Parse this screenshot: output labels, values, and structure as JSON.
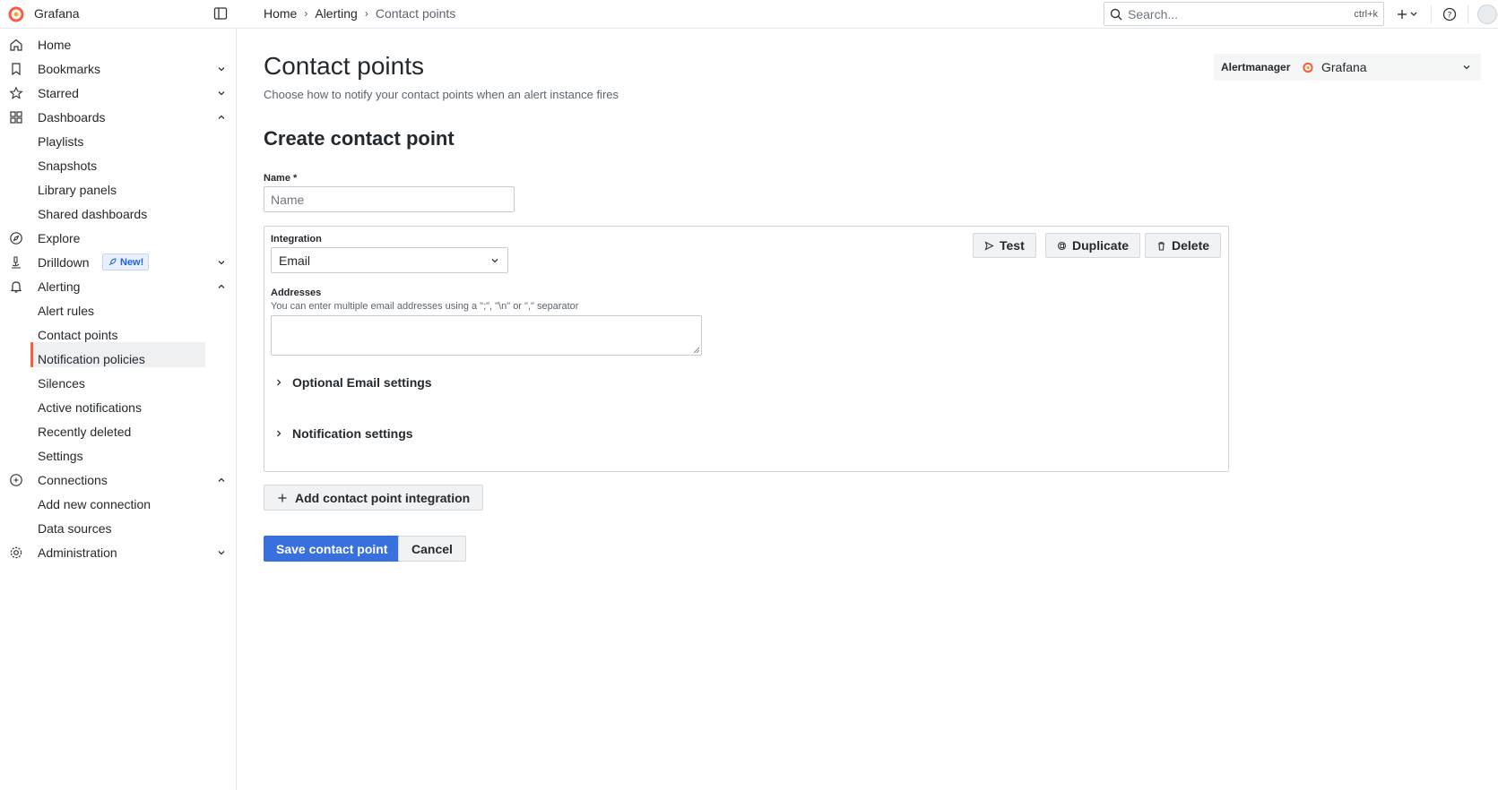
{
  "app": {
    "name": "Grafana",
    "logo_color": "#f55f3e"
  },
  "breadcrumbs": [
    "Home",
    "Alerting",
    "Contact points"
  ],
  "search": {
    "placeholder": "Search...",
    "shortcut": "ctrl+k"
  },
  "sidebar": {
    "items": [
      {
        "label": "Home",
        "icon": "home-icon"
      },
      {
        "label": "Bookmarks",
        "icon": "bookmark-icon",
        "expand": "down"
      },
      {
        "label": "Starred",
        "icon": "star-icon",
        "expand": "down"
      },
      {
        "label": "Dashboards",
        "icon": "apps-icon",
        "expand": "up"
      },
      {
        "label": "Playlists",
        "child": true
      },
      {
        "label": "Snapshots",
        "child": true
      },
      {
        "label": "Library panels",
        "child": true
      },
      {
        "label": "Shared dashboards",
        "child": true
      },
      {
        "label": "Explore",
        "icon": "compass-icon"
      },
      {
        "label": "Drilldown",
        "icon": "microscope-icon",
        "expand": "down",
        "badge": "New!"
      },
      {
        "label": "Alerting",
        "icon": "bell-icon",
        "expand": "up"
      },
      {
        "label": "Alert rules",
        "child": true
      },
      {
        "label": "Contact points",
        "child": true,
        "active": true
      },
      {
        "label": "Notification policies",
        "child": true
      },
      {
        "label": "Silences",
        "child": true
      },
      {
        "label": "Active notifications",
        "child": true
      },
      {
        "label": "Recently deleted",
        "child": true
      },
      {
        "label": "Settings",
        "child": true
      },
      {
        "label": "Connections",
        "icon": "link-icon",
        "expand": "up"
      },
      {
        "label": "Add new connection",
        "child": true
      },
      {
        "label": "Data sources",
        "child": true
      },
      {
        "label": "Administration",
        "icon": "cog-icon",
        "expand": "down"
      }
    ]
  },
  "page": {
    "title": "Contact points",
    "subtitle": "Choose how to notify your contact points when an alert instance fires",
    "alertmanager_label": "Alertmanager",
    "alertmanager_value": "Grafana"
  },
  "form": {
    "section_title": "Create contact point",
    "name_label": "Name *",
    "name_placeholder": "Name",
    "integration_label": "Integration",
    "integration_value": "Email",
    "test_label": "Test",
    "duplicate_label": "Duplicate",
    "delete_label": "Delete",
    "addresses_label": "Addresses",
    "addresses_help": "You can enter multiple email addresses using a \";\", \"\\n\" or \",\" separator",
    "optional_settings": "Optional Email settings",
    "notification_settings": "Notification settings",
    "add_integration": "Add contact point integration",
    "save": "Save contact point",
    "cancel": "Cancel"
  },
  "colors": {
    "primary": "#3871dc",
    "accent": "#f55f3e"
  }
}
